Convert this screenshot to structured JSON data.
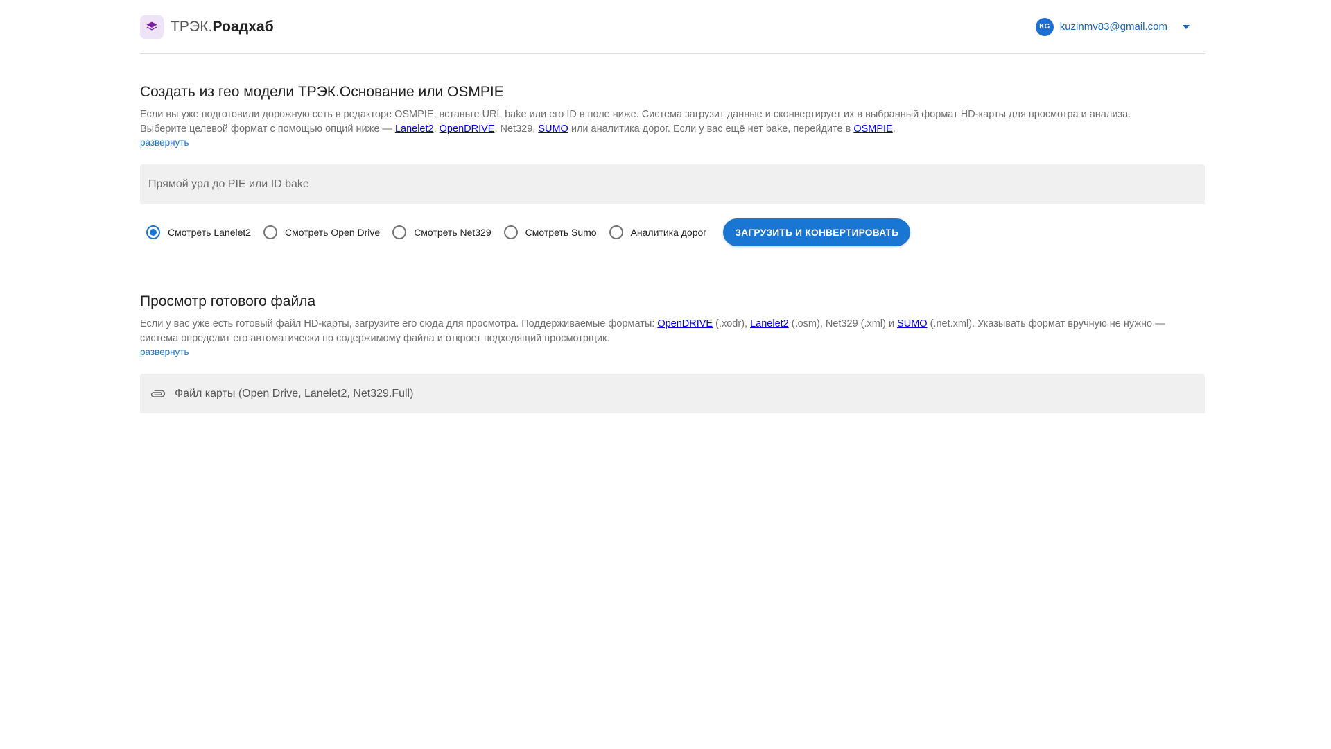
{
  "header": {
    "brand_light": "ТРЭК.",
    "brand_bold": "Роадхаб",
    "avatar_initials": "KG",
    "user_email": "kuzinmv83@gmail.com"
  },
  "section1": {
    "title": "Создать из гео модели ТРЭК.Основание или OSMPIE",
    "desc_line1": "Если вы уже подготовили дорожную сеть в редакторе OSMPIE, вставьте URL bake или его ID в поле ниже. Система загрузит данные и сконвертирует их в выбранный формат HD-карты для просмотра и анализа.",
    "desc_line2_a": "Выберите целевой формат с помощью опций ниже — ",
    "link_lanelet2": "Lanelet2",
    "sep1": ", ",
    "link_opendrive": "OpenDRIVE",
    "sep2": ", Net329, ",
    "link_sumo": "SUMO",
    "desc_line2_b": " или аналитика дорог. Если у вас ещё нет bake, перейдите в ",
    "link_osmpie": "OSMPIE",
    "desc_end": ".",
    "expand": "развернуть",
    "input_placeholder": "Прямой урл до PIE или ID bake",
    "input_value": "",
    "options": [
      {
        "label": "Смотреть Lanelet2",
        "checked": true
      },
      {
        "label": "Смотреть Open Drive",
        "checked": false
      },
      {
        "label": "Смотреть Net329",
        "checked": false
      },
      {
        "label": "Смотреть Sumo",
        "checked": false
      },
      {
        "label": "Аналитика дорог",
        "checked": false
      }
    ],
    "button_label": "ЗАГРУЗИТЬ И КОНВЕРТИРОВАТЬ"
  },
  "section2": {
    "title": "Просмотр готового файла",
    "desc_a": "Если у вас уже есть готовый файл HD-карты, загрузите его сюда для просмотра. Поддерживаемые форматы: ",
    "link_opendrive": "OpenDRIVE",
    "desc_b": " (.xodr), ",
    "link_lanelet2": "Lanelet2",
    "desc_c": " (.osm), Net329 (.xml) и ",
    "link_sumo": "SUMO",
    "desc_d": " (.net.xml). Указывать формат вручную не нужно —",
    "desc_line2": "система определит его автоматически по содержимому файла и откроет подходящий просмотрщик.",
    "expand": "развернуть",
    "file_label": "Файл карты (Open Drive, Lanelet2, Net329.Full)"
  },
  "colors": {
    "accent": "#1976d2",
    "link": "#0000ee",
    "logo_bg": "#efe3f7",
    "logo_icon": "#7b1fa2"
  },
  "icons": {
    "logo": "layers-icon",
    "caret": "arrow-drop-down-icon",
    "file": "paperclip-icon"
  }
}
